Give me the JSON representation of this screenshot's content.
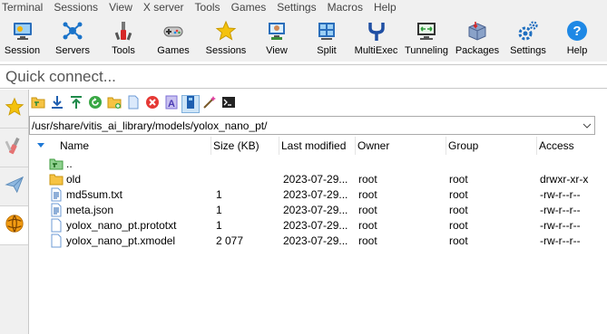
{
  "menubar": [
    "Terminal",
    "Sessions",
    "View",
    "X server",
    "Tools",
    "Games",
    "Settings",
    "Macros",
    "Help"
  ],
  "toolbar": [
    {
      "label": "Session",
      "icon": "session-monitor-icon"
    },
    {
      "label": "Servers",
      "icon": "servers-network-icon"
    },
    {
      "label": "Tools",
      "icon": "tools-icon"
    },
    {
      "label": "Games",
      "icon": "gamepad-icon"
    },
    {
      "label": "Sessions",
      "icon": "star-icon"
    },
    {
      "label": "View",
      "icon": "view-monitor-icon"
    },
    {
      "label": "Split",
      "icon": "split-icon"
    },
    {
      "label": "MultiExec",
      "icon": "multiexec-fork-icon"
    },
    {
      "label": "Tunneling",
      "icon": "tunneling-icon"
    },
    {
      "label": "Packages",
      "icon": "packages-icon"
    },
    {
      "label": "Settings",
      "icon": "gears-icon"
    },
    {
      "label": "Help",
      "icon": "help-icon"
    }
  ],
  "quick_connect": {
    "placeholder": "Quick connect..."
  },
  "side_tabs": [
    "star-icon",
    "tools-icon",
    "paper-plane-icon",
    "sftp-globe-icon"
  ],
  "sftp": {
    "path": "/usr/share/vitis_ai_library/models/yolox_nano_pt/",
    "columns": {
      "name": "Name",
      "size": "Size (KB)",
      "modified": "Last modified",
      "owner": "Owner",
      "group": "Group",
      "access": "Access"
    },
    "files": [
      {
        "name": "..",
        "size": "",
        "modified": "",
        "owner": "",
        "group": "",
        "access": "",
        "icon": "parent-folder-icon"
      },
      {
        "name": "old",
        "size": "",
        "modified": "2023-07-29...",
        "owner": "root",
        "group": "root",
        "access": "drwxr-xr-x",
        "icon": "folder-icon"
      },
      {
        "name": "md5sum.txt",
        "size": "1",
        "modified": "2023-07-29...",
        "owner": "root",
        "group": "root",
        "access": "-rw-r--r--",
        "icon": "text-file-icon"
      },
      {
        "name": "meta.json",
        "size": "1",
        "modified": "2023-07-29...",
        "owner": "root",
        "group": "root",
        "access": "-rw-r--r--",
        "icon": "text-file-icon"
      },
      {
        "name": "yolox_nano_pt.prototxt",
        "size": "1",
        "modified": "2023-07-29...",
        "owner": "root",
        "group": "root",
        "access": "-rw-r--r--",
        "icon": "file-icon"
      },
      {
        "name": "yolox_nano_pt.xmodel",
        "size": "2 077",
        "modified": "2023-07-29...",
        "owner": "root",
        "group": "root",
        "access": "-rw-r--r--",
        "icon": "file-icon"
      }
    ]
  }
}
